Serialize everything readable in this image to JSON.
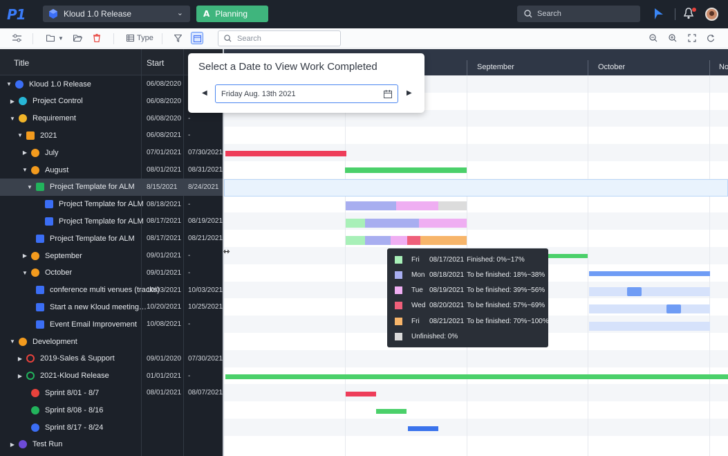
{
  "app": {
    "logo": "P1",
    "project": "Kloud 1.0 Release",
    "planning_label": "Planning",
    "search_placeholder": "Search",
    "notification_count": 1
  },
  "toolbar": {
    "type_label": "Type",
    "search_placeholder": "Search"
  },
  "columns": {
    "title": "Title",
    "start": "Start"
  },
  "rows": [
    {
      "title": "Kloud 1.0 Release",
      "start": "06/08/2020",
      "end": "",
      "icon": "cube-icon",
      "color": "#3b6ef5",
      "toggle": "expanded",
      "indent": 0
    },
    {
      "title": "Project Control",
      "start": "06/08/2020",
      "end": "",
      "icon": "project-control-icon",
      "color": "#27b6d6",
      "toggle": "collapsed",
      "indent": 1
    },
    {
      "title": "Requirement",
      "start": "06/08/2020",
      "end": "-",
      "icon": "requirement-icon",
      "color": "#f0b429",
      "toggle": "expanded",
      "indent": 1
    },
    {
      "title": "2021",
      "start": "06/08/2021",
      "end": "-",
      "icon": "folder-icon",
      "color": "#f39b1e",
      "toggle": "expanded",
      "indent": 2
    },
    {
      "title": "July",
      "start": "07/01/2021",
      "end": "07/30/2021",
      "icon": "iteration-icon",
      "color": "#f39b1e",
      "toggle": "collapsed",
      "indent": 3
    },
    {
      "title": "August",
      "start": "08/01/2021",
      "end": "08/31/2021",
      "icon": "iteration-icon",
      "color": "#f39b1e",
      "toggle": "expanded",
      "indent": 3
    },
    {
      "title": "Project Template for ALM",
      "start": "8/15/2021",
      "end": "8/24/2021",
      "icon": "story-icon",
      "color": "#22b35c",
      "toggle": "expanded",
      "indent": 4
    },
    {
      "title": "Project Template for ALM",
      "start": "08/18/2021",
      "end": "-",
      "icon": "task-icon",
      "color": "#3b6ef5",
      "toggle": "none",
      "indent": 5
    },
    {
      "title": "Project Template for ALM",
      "start": "08/17/2021",
      "end": "08/19/2021",
      "icon": "task-icon",
      "color": "#3b6ef5",
      "toggle": "none",
      "indent": 5
    },
    {
      "title": "Project Template for ALM",
      "start": "08/17/2021",
      "end": "08/21/2021",
      "icon": "task-icon",
      "color": "#3b6ef5",
      "toggle": "none",
      "indent": 4
    },
    {
      "title": "September",
      "start": "09/01/2021",
      "end": "-",
      "icon": "iteration-icon",
      "color": "#f39b1e",
      "toggle": "collapsed",
      "indent": 3
    },
    {
      "title": "October",
      "start": "09/01/2021",
      "end": "-",
      "icon": "iteration-icon",
      "color": "#f39b1e",
      "toggle": "expanded",
      "indent": 3
    },
    {
      "title": "conference multi venues (tracks)",
      "start": "10/03/2021",
      "end": "10/03/2021",
      "icon": "task-icon",
      "color": "#3b6ef5",
      "toggle": "none",
      "indent": 4
    },
    {
      "title": "Start a new Kloud meeting…",
      "start": "10/20/2021",
      "end": "10/25/2021",
      "icon": "task-icon",
      "color": "#3b6ef5",
      "toggle": "none",
      "indent": 4
    },
    {
      "title": "Event Email Improvement",
      "start": "10/08/2021",
      "end": "-",
      "icon": "task-icon",
      "color": "#3b6ef5",
      "toggle": "none",
      "indent": 4
    },
    {
      "title": "Development",
      "start": "",
      "end": "",
      "icon": "development-icon",
      "color": "#f39b1e",
      "toggle": "expanded",
      "indent": 1
    },
    {
      "title": "2019-Sales & Support",
      "start": "09/01/2020",
      "end": "07/30/2021",
      "icon": "release-icon",
      "color": "#e8423c",
      "toggle": "collapsed",
      "indent": 2
    },
    {
      "title": "2021-Kloud Release",
      "start": "01/01/2021",
      "end": "-",
      "icon": "release-icon",
      "color": "#22b35c",
      "toggle": "collapsed",
      "indent": 2
    },
    {
      "title": "Sprint 8/01 - 8/7",
      "start": "08/01/2021",
      "end": "08/07/2021",
      "icon": "sprint-icon",
      "color": "#e8423c",
      "toggle": "none",
      "indent": 3
    },
    {
      "title": "Sprint 8/08 - 8/16",
      "start": "",
      "end": "",
      "icon": "sprint-icon",
      "color": "#22b35c",
      "toggle": "none",
      "indent": 3
    },
    {
      "title": "Sprint 8/17 - 8/24",
      "start": "",
      "end": "",
      "icon": "sprint-icon",
      "color": "#3b6ef5",
      "toggle": "none",
      "indent": 3
    },
    {
      "title": "Test Run",
      "start": "",
      "end": "",
      "icon": "test-run-icon",
      "color": "#6d4bd8",
      "toggle": "collapsed",
      "indent": 1
    }
  ],
  "timeline": {
    "months": [
      "September",
      "October",
      "No"
    ]
  },
  "date_popup": {
    "title": "Select a Date to View Work Completed",
    "date_value": "Friday Aug. 13th 2021"
  },
  "tooltip": {
    "items": [
      {
        "day": "Fri",
        "date": "08/17/2021",
        "text": "Finished: 0%~17%",
        "color": "#a8f0b8"
      },
      {
        "day": "Mon",
        "date": "08/18/2021",
        "text": "To be finished: 18%~38%",
        "color": "#a8aef0"
      },
      {
        "day": "Tue",
        "date": "08/19/2021",
        "text": "To be finished: 39%~56%",
        "color": "#efaef2"
      },
      {
        "day": "Wed",
        "date": "08/20/2021",
        "text": "To be finished: 57%~69%",
        "color": "#ef5f7a"
      },
      {
        "day": "Fri",
        "date": "08/21/2021",
        "text": "To be finished: 70%~100%",
        "color": "#f7b56a"
      },
      {
        "day": "",
        "date": "",
        "text": "Unfinished: 0%",
        "color": "#d9d9d9"
      }
    ]
  }
}
